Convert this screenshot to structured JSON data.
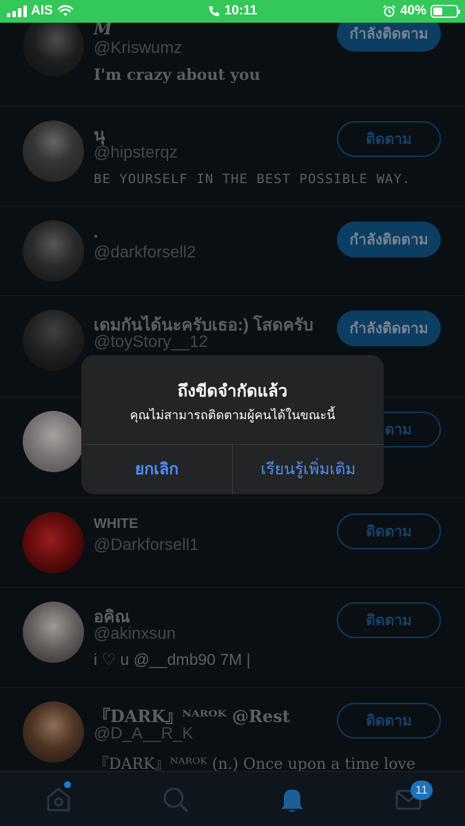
{
  "status_bar": {
    "carrier": "AIS",
    "time": "10:11",
    "battery": "40%",
    "battery_level": 0.4
  },
  "users": [
    {
      "name": "𝑴",
      "handle": "@Kriswumz",
      "bio": "I'm crazy about you",
      "button": "กำลังติดตาม",
      "state": "following"
    },
    {
      "name": "นุ",
      "handle": "@hipsterqz",
      "bio": "BE YOURSELF IN THE BEST POSSIBLE WAY.",
      "button": "ติดตาม",
      "state": "follow"
    },
    {
      "name": ".",
      "handle": "@darkforsell2",
      "bio": "",
      "button": "กำลังติดตาม",
      "state": "following"
    },
    {
      "name": "เดมกันได้นะครับเธอ:) โสดครับ",
      "handle": "@toyStory__12",
      "bio": "",
      "button": "กำลังติดตาม",
      "state": "following"
    },
    {
      "name": "",
      "handle": "",
      "bio": "",
      "button": "ติดตาม",
      "state": "follow"
    },
    {
      "name": "WHITE",
      "handle": "@Darkforsell1",
      "bio": "",
      "button": "ติดตาม",
      "state": "follow"
    },
    {
      "name": "อคิณ",
      "handle": "@akinxsun",
      "bio": "i ♡ u @__dmb90 7M |",
      "button": "ติดตาม",
      "state": "follow"
    },
    {
      "name": "『DARK』ᴺᴬᴿᴼᴷ @Rest",
      "handle": "@D_A__R_K",
      "bio": "『DARK』ᴺᴬᴿᴼᴷ (n.) Once upon a time love",
      "button": "ติดตาม",
      "state": "follow"
    }
  ],
  "alert": {
    "title": "ถึงขีดจำกัดแล้ว",
    "message": "คุณไม่สามารถติดตามผู้คนได้ในขณะนี้",
    "cancel": "ยกเลิก",
    "learn_more": "เรียนรู้เพิ่มเติม"
  },
  "tabbar": {
    "messages_badge": "11"
  },
  "colors": {
    "status_bar": "#34c759",
    "background": "#0f151c",
    "accent": "#1d9bf0",
    "alert_button": "#4d8ef7"
  }
}
